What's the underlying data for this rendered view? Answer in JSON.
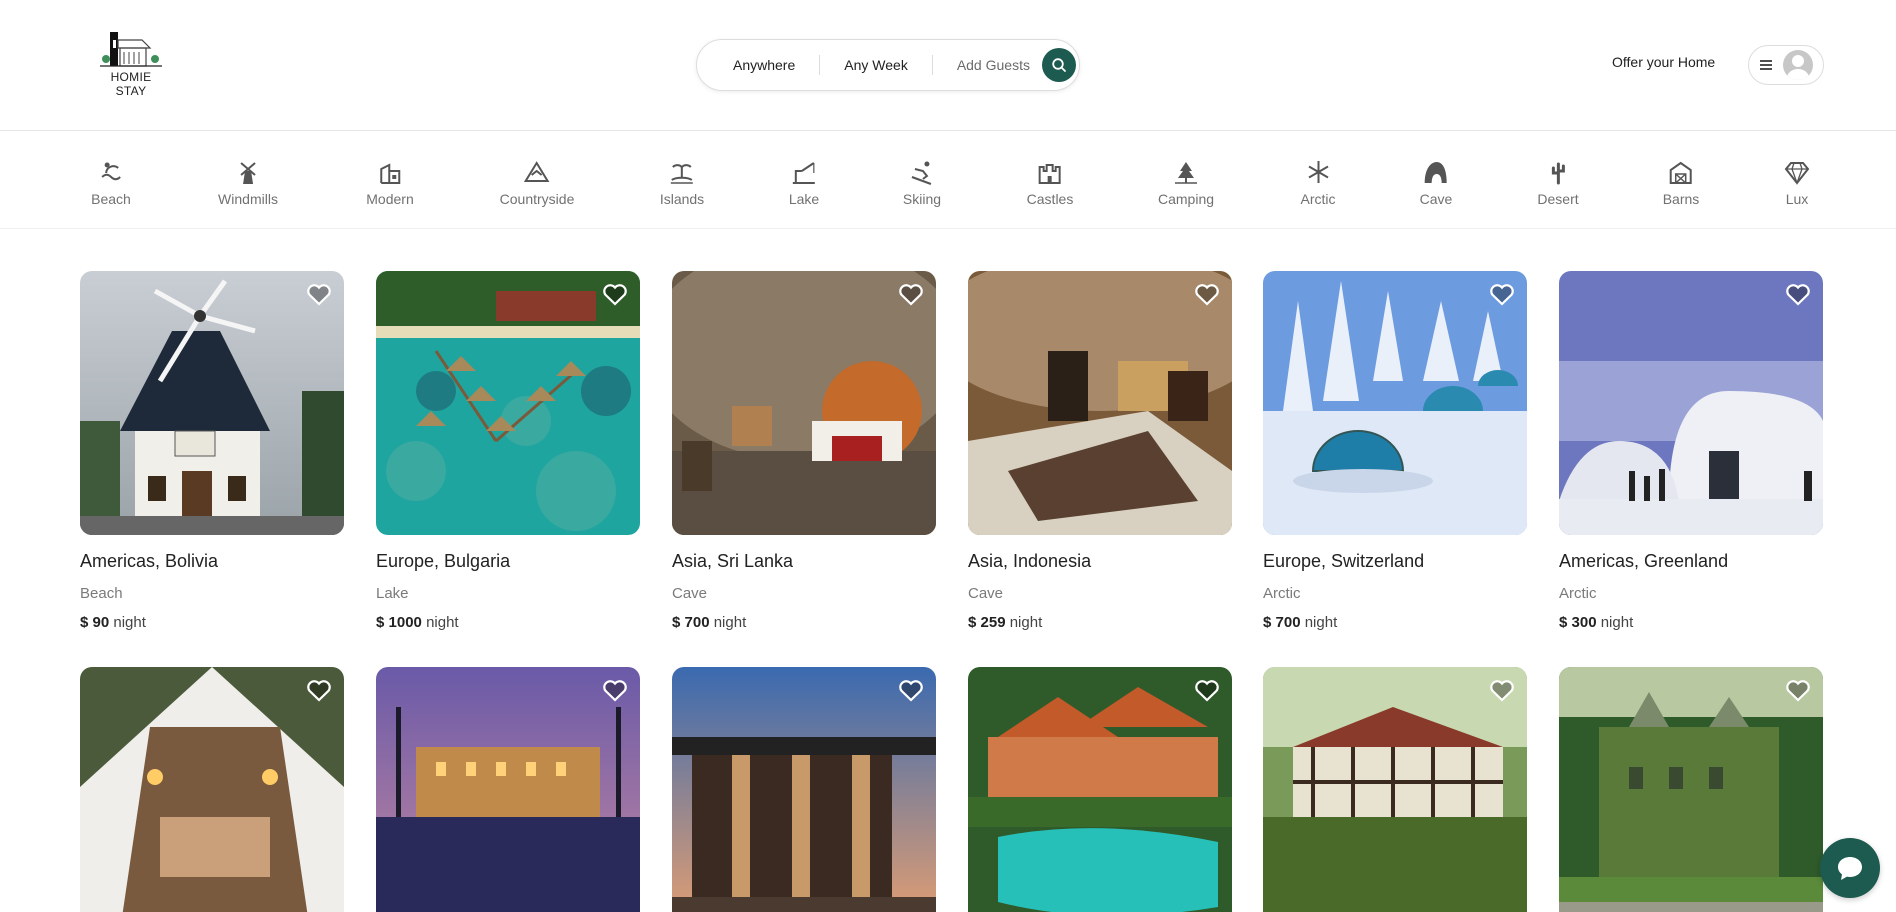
{
  "header": {
    "logo_text_1": "HOMIE",
    "logo_text_2": "STAY",
    "search": {
      "where": "Anywhere",
      "when": "Any Week",
      "guests": "Add Guests"
    },
    "offer_link": "Offer your Home"
  },
  "categories": [
    {
      "label": "Beach",
      "icon": "beach-icon"
    },
    {
      "label": "Windmills",
      "icon": "windmill-icon"
    },
    {
      "label": "Modern",
      "icon": "modern-house-icon"
    },
    {
      "label": "Countryside",
      "icon": "mountain-icon"
    },
    {
      "label": "Islands",
      "icon": "island-icon"
    },
    {
      "label": "Lake",
      "icon": "lake-fishing-icon"
    },
    {
      "label": "Skiing",
      "icon": "skiing-icon"
    },
    {
      "label": "Castles",
      "icon": "castle-icon"
    },
    {
      "label": "Camping",
      "icon": "camping-tree-icon"
    },
    {
      "label": "Arctic",
      "icon": "snowflake-icon"
    },
    {
      "label": "Cave",
      "icon": "cave-icon"
    },
    {
      "label": "Desert",
      "icon": "cactus-icon"
    },
    {
      "label": "Barns",
      "icon": "barn-icon"
    },
    {
      "label": "Lux",
      "icon": "diamond-icon"
    }
  ],
  "listings": [
    {
      "location": "Americas, Bolivia",
      "category": "Beach",
      "price": "$ 90",
      "per": "night",
      "photo": "windmill-house"
    },
    {
      "location": "Europe, Bulgaria",
      "category": "Lake",
      "price": "$ 1000",
      "per": "night",
      "photo": "overwater-bungalows"
    },
    {
      "location": "Asia, Sri Lanka",
      "category": "Cave",
      "price": "$ 700",
      "per": "night",
      "photo": "cave-bedroom"
    },
    {
      "location": "Asia, Indonesia",
      "category": "Cave",
      "price": "$ 259",
      "per": "night",
      "photo": "cave-suite"
    },
    {
      "location": "Europe, Switzerland",
      "category": "Arctic",
      "price": "$ 700",
      "per": "night",
      "photo": "glass-igloos"
    },
    {
      "location": "Americas, Greenland",
      "category": "Arctic",
      "price": "$ 300",
      "per": "night",
      "photo": "ice-hotel"
    },
    {
      "location": "",
      "category": "",
      "price": "",
      "per": "",
      "photo": "glamping-tent"
    },
    {
      "location": "",
      "category": "",
      "price": "",
      "per": "",
      "photo": "palace-pool-dusk"
    },
    {
      "location": "",
      "category": "",
      "price": "",
      "per": "",
      "photo": "modern-pavilion"
    },
    {
      "location": "",
      "category": "",
      "price": "",
      "per": "",
      "photo": "tropical-resort-pool"
    },
    {
      "location": "",
      "category": "",
      "price": "",
      "per": "",
      "photo": "tudor-manor"
    },
    {
      "location": "",
      "category": "",
      "price": "",
      "per": "",
      "photo": "ivy-castle"
    }
  ],
  "colors": {
    "brand": "#1d5a4f",
    "muted_text": "#717171",
    "border": "#dddddd"
  }
}
